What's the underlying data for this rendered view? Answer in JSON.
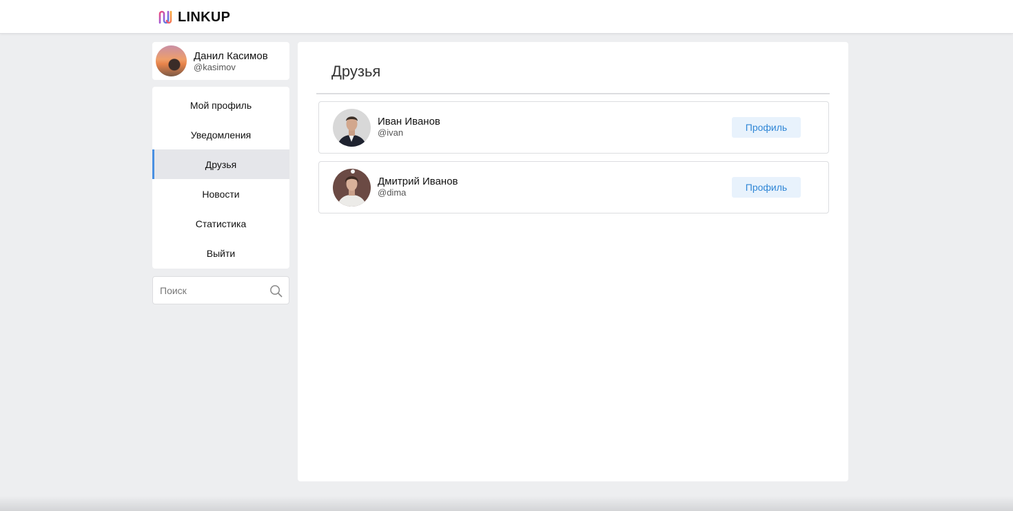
{
  "header": {
    "logo_text": "LINKUP",
    "logo_icon": "linkup-logo-icon"
  },
  "user": {
    "name": "Данил Касимов",
    "handle": "@kasimov"
  },
  "nav": {
    "items": [
      {
        "label": "Мой профиль"
      },
      {
        "label": "Уведомления"
      },
      {
        "label": "Друзья",
        "active": true
      },
      {
        "label": "Новости"
      },
      {
        "label": "Статистика"
      },
      {
        "label": "Выйти"
      }
    ]
  },
  "search": {
    "placeholder": "Поиск",
    "icon": "search-icon"
  },
  "main": {
    "title": "Друзья",
    "friends": [
      {
        "name": "Иван Иванов",
        "handle": "@ivan",
        "button_label": "Профиль"
      },
      {
        "name": "Дмитрий Иванов",
        "handle": "@dima",
        "button_label": "Профиль"
      }
    ]
  },
  "colors": {
    "accent": "#4a90e2",
    "button_bg": "#e8f2fc",
    "button_text": "#2f86d6",
    "page_bg": "#edeef0"
  }
}
